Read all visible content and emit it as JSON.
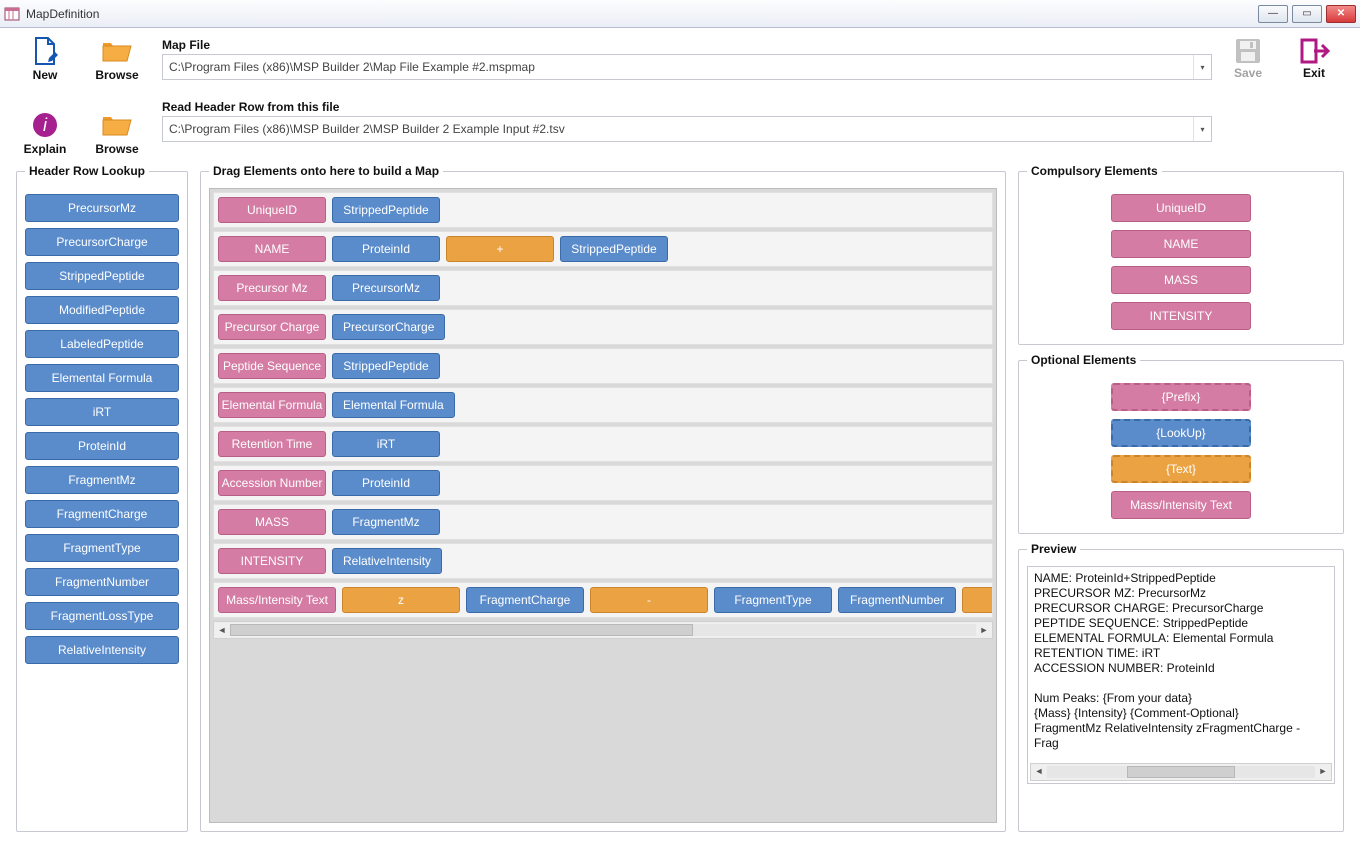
{
  "window": {
    "title": "MapDefinition"
  },
  "toolbar": {
    "new": "New",
    "browse": "Browse",
    "explain": "Explain",
    "save": "Save",
    "exit": "Exit"
  },
  "files": {
    "map_label": "Map File",
    "map_path": "C:\\Program Files (x86)\\MSP Builder 2\\Map File Example #2.mspmap",
    "header_label": "Read Header Row from this file",
    "header_path": "C:\\Program Files (x86)\\MSP Builder 2\\MSP Builder 2 Example Input #2.tsv"
  },
  "lookup": {
    "title": "Header Row Lookup",
    "items": [
      "PrecursorMz",
      "PrecursorCharge",
      "StrippedPeptide",
      "ModifiedPeptide",
      "LabeledPeptide",
      "Elemental Formula",
      "iRT",
      "ProteinId",
      "FragmentMz",
      "FragmentCharge",
      "FragmentType",
      "FragmentNumber",
      "FragmentLossType",
      "RelativeIntensity"
    ]
  },
  "builder": {
    "title": "Drag Elements onto here to build a Map",
    "rows": [
      [
        {
          "t": "UniqueID",
          "c": "pink"
        },
        {
          "t": "StrippedPeptide",
          "c": "blue"
        }
      ],
      [
        {
          "t": "NAME",
          "c": "pink"
        },
        {
          "t": "ProteinId",
          "c": "blue"
        },
        {
          "t": "+",
          "c": "orange"
        },
        {
          "t": "StrippedPeptide",
          "c": "blue"
        }
      ],
      [
        {
          "t": "Precursor Mz",
          "c": "pink"
        },
        {
          "t": "PrecursorMz",
          "c": "blue"
        }
      ],
      [
        {
          "t": "Precursor Charge",
          "c": "pink"
        },
        {
          "t": "PrecursorCharge",
          "c": "blue"
        }
      ],
      [
        {
          "t": "Peptide Sequence",
          "c": "pink"
        },
        {
          "t": "StrippedPeptide",
          "c": "blue"
        }
      ],
      [
        {
          "t": "Elemental Formula",
          "c": "pink"
        },
        {
          "t": "Elemental Formula",
          "c": "blue"
        }
      ],
      [
        {
          "t": "Retention Time",
          "c": "pink"
        },
        {
          "t": "iRT",
          "c": "blue"
        }
      ],
      [
        {
          "t": "Accession Number",
          "c": "pink"
        },
        {
          "t": "ProteinId",
          "c": "blue"
        }
      ],
      [
        {
          "t": "MASS",
          "c": "pink"
        },
        {
          "t": "FragmentMz",
          "c": "blue"
        }
      ],
      [
        {
          "t": "INTENSITY",
          "c": "pink"
        },
        {
          "t": "RelativeIntensity",
          "c": "blue"
        }
      ],
      [
        {
          "t": "Mass/Intensity Text",
          "c": "pink"
        },
        {
          "t": "z",
          "c": "orange"
        },
        {
          "t": "FragmentCharge",
          "c": "blue"
        },
        {
          "t": "-",
          "c": "orange"
        },
        {
          "t": "FragmentType",
          "c": "blue"
        },
        {
          "t": "FragmentNumber",
          "c": "blue"
        },
        {
          "t": "&",
          "c": "orange"
        }
      ]
    ]
  },
  "compulsory": {
    "title": "Compulsory Elements",
    "items": [
      {
        "t": "UniqueID"
      },
      {
        "t": "NAME"
      },
      {
        "t": "MASS"
      },
      {
        "t": "INTENSITY"
      }
    ]
  },
  "optional": {
    "title": "Optional Elements",
    "items": [
      {
        "t": "{Prefix}",
        "c": "pink",
        "d": true
      },
      {
        "t": "{LookUp}",
        "c": "blue",
        "d": true
      },
      {
        "t": "{Text}",
        "c": "orange",
        "d": true
      },
      {
        "t": "Mass/Intensity Text",
        "c": "pink",
        "d": false
      }
    ]
  },
  "preview": {
    "title": "Preview",
    "lines": [
      "NAME: ProteinId+StrippedPeptide",
      "PRECURSOR MZ: PrecursorMz",
      "PRECURSOR CHARGE: PrecursorCharge",
      "PEPTIDE SEQUENCE: StrippedPeptide",
      "ELEMENTAL FORMULA: Elemental Formula",
      "RETENTION TIME: iRT",
      "ACCESSION NUMBER: ProteinId",
      "",
      "Num Peaks: {From your data}",
      "{Mass}          {Intensity}               {Comment-Optional}",
      "FragmentMz    RelativeIntensity       zFragmentCharge - Frag"
    ]
  }
}
